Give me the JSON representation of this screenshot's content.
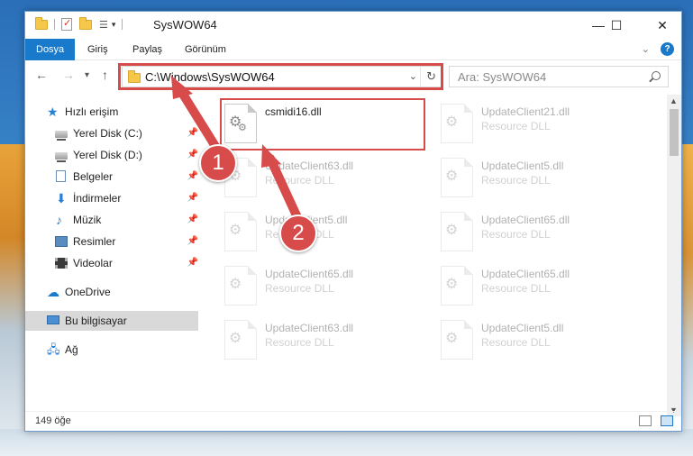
{
  "window": {
    "title": "SysWOW64",
    "controls": {
      "minimize": "—",
      "maximize": "☐",
      "close": "✕"
    }
  },
  "ribbon": {
    "tabs": [
      "Dosya",
      "Giriş",
      "Paylaş",
      "Görünüm"
    ],
    "active_tab": "Dosya",
    "help": "?"
  },
  "address": {
    "path": "C:\\Windows\\SysWOW64",
    "search_placeholder": "Ara: SysWOW64"
  },
  "sidebar": {
    "items": [
      {
        "label": "Hızlı erişim",
        "icon": "star-icon",
        "pinned": false
      },
      {
        "label": "Yerel Disk (C:)",
        "icon": "drive-icon",
        "pinned": true
      },
      {
        "label": "Yerel Disk (D:)",
        "icon": "drive-icon",
        "pinned": true
      },
      {
        "label": "Belgeler",
        "icon": "documents-icon",
        "pinned": true
      },
      {
        "label": "İndirmeler",
        "icon": "download-icon",
        "pinned": true
      },
      {
        "label": "Müzik",
        "icon": "music-icon",
        "pinned": true
      },
      {
        "label": "Resimler",
        "icon": "pictures-icon",
        "pinned": true
      },
      {
        "label": "Videolar",
        "icon": "video-icon",
        "pinned": true
      },
      {
        "label": "OneDrive",
        "icon": "cloud-icon",
        "pinned": false
      },
      {
        "label": "Bu bilgisayar",
        "icon": "computer-icon",
        "pinned": false,
        "selected": true
      },
      {
        "label": "Ağ",
        "icon": "network-icon",
        "pinned": false
      }
    ]
  },
  "files": [
    {
      "name": "csmidi16.dll",
      "type": "",
      "highlighted": true
    },
    {
      "name": "UpdateClient21.dll",
      "type": "Resource DLL",
      "faded": true
    },
    {
      "name": "UpdateClient63.dll",
      "type": "Resource DLL",
      "faded": true
    },
    {
      "name": "UpdateClient5.dll",
      "type": "Resource DLL",
      "faded": true
    },
    {
      "name": "UpdateClient5.dll",
      "type": "Resource DLL",
      "faded": true
    },
    {
      "name": "UpdateClient65.dll",
      "type": "Resource DLL",
      "faded": true
    },
    {
      "name": "UpdateClient65.dll",
      "type": "Resource DLL",
      "faded": true
    },
    {
      "name": "UpdateClient65.dll",
      "type": "Resource DLL",
      "faded": true
    },
    {
      "name": "UpdateClient63.dll",
      "type": "Resource DLL",
      "faded": true
    },
    {
      "name": "UpdateClient5.dll",
      "type": "Resource DLL",
      "faded": true
    }
  ],
  "status": {
    "item_count": "149 öğe"
  },
  "callouts": {
    "step1": "1",
    "step2": "2"
  },
  "colors": {
    "accent": "#1979ca",
    "highlight": "#d84b4b"
  }
}
